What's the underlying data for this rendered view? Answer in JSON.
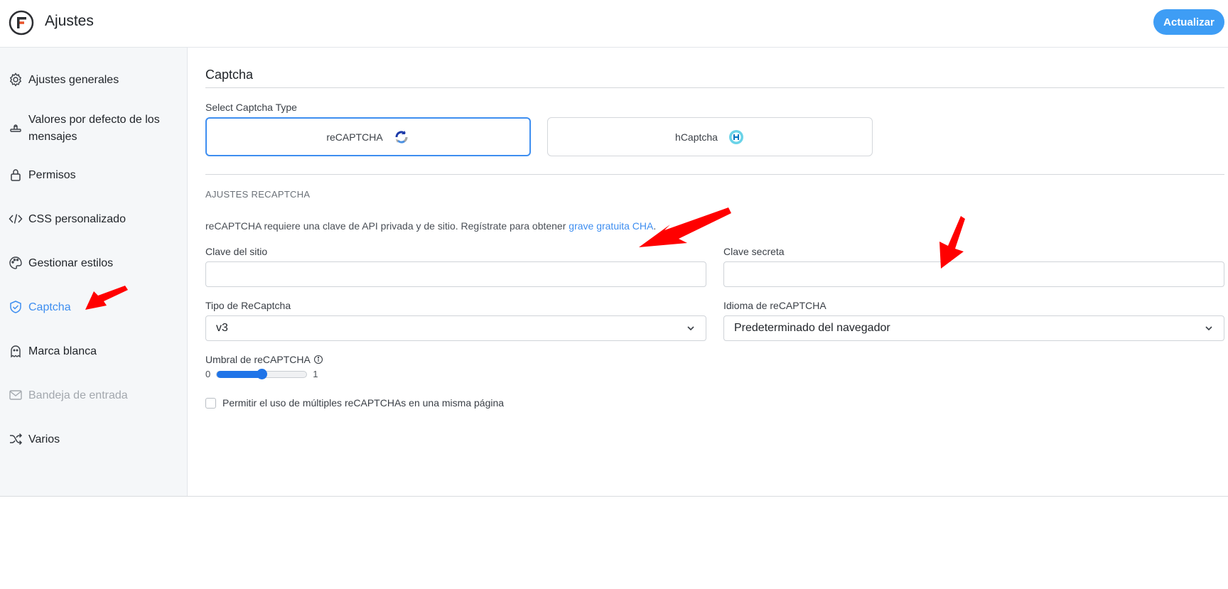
{
  "header": {
    "title": "Ajustes",
    "update_label": "Actualizar"
  },
  "sidebar": {
    "items": [
      {
        "label": "Ajustes generales",
        "icon": "gear-icon",
        "state": "normal"
      },
      {
        "label": "Valores por defecto de los mensajes",
        "icon": "stamp-icon",
        "state": "normal"
      },
      {
        "label": "Permisos",
        "icon": "lock-icon",
        "state": "normal"
      },
      {
        "label": "CSS personalizado",
        "icon": "code-icon",
        "state": "normal"
      },
      {
        "label": "Gestionar estilos",
        "icon": "palette-icon",
        "state": "normal"
      },
      {
        "label": "Captcha",
        "icon": "shield-check-icon",
        "state": "active"
      },
      {
        "label": "Marca blanca",
        "icon": "ghost-icon",
        "state": "normal"
      },
      {
        "label": "Bandeja de entrada",
        "icon": "mail-icon",
        "state": "disabled"
      },
      {
        "label": "Varios",
        "icon": "shuffle-icon",
        "state": "normal"
      }
    ]
  },
  "main": {
    "section_title": "Captcha",
    "select_label": "Select Captcha Type",
    "captcha_types": [
      {
        "label": "reCAPTCHA",
        "icon": "recaptcha-icon",
        "selected": true
      },
      {
        "label": "hCaptcha",
        "icon": "hcaptcha-icon",
        "selected": false
      }
    ],
    "subhead": "AJUSTES RECAPTCHA",
    "info_text": "reCAPTCHA requiere una clave de API privada y de sitio. Regístrate para obtener ",
    "info_link": "grave gratuita",
    "info_link_tail": " CHA",
    "info_end": ".",
    "site_key_label": "Clave del sitio",
    "site_key_value": "",
    "secret_key_label": "Clave secreta",
    "secret_key_value": "",
    "type_label": "Tipo de ReCaptcha",
    "type_value": "v3",
    "language_label": "Idioma de reCAPTCHA",
    "language_value": "Predeterminado del navegador",
    "threshold_label": "Umbral de reCAPTCHA",
    "threshold_min": "0",
    "threshold_max": "1",
    "threshold_value": 0.5,
    "multiple_label": "Permitir el uso de múltiples reCAPTCHAs en una misma página",
    "multiple_checked": false
  },
  "colors": {
    "accent": "#3e8ef0",
    "update_button": "#3e9df5",
    "annotation_arrow": "#ff0000"
  }
}
